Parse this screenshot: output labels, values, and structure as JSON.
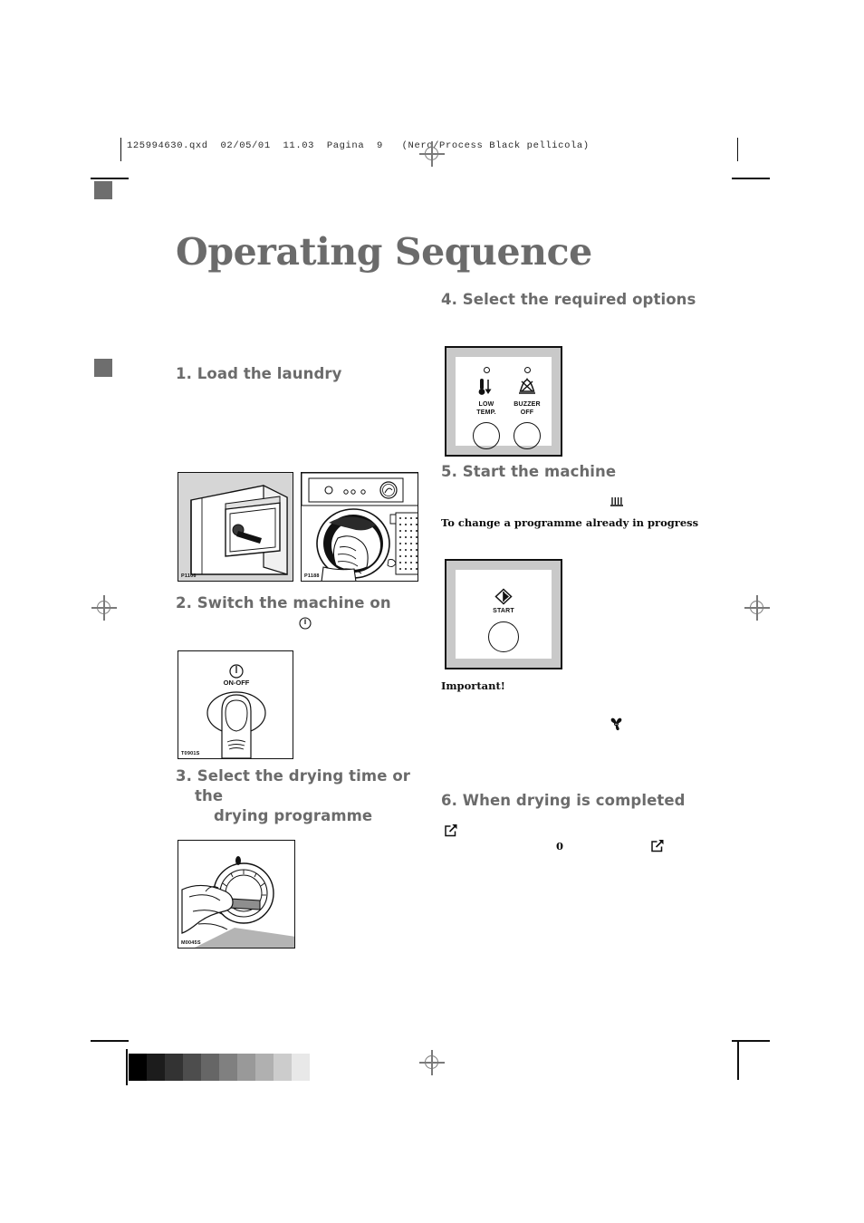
{
  "prepress": {
    "header_line": "125994630.qxd  02/05/01  11.03  Pagina  9   (Nero/Process Black pellicola)",
    "greyscale_steps": [
      "#000000",
      "#1c1c1c",
      "#333333",
      "#4d4d4d",
      "#666666",
      "#808080",
      "#999999",
      "#b0b0b0",
      "#cccccc",
      "#e8e8e8"
    ],
    "marker_color": "#6e6e6e"
  },
  "page": {
    "title": "Operating Sequence"
  },
  "left_column": {
    "step1": {
      "heading": "1. Load the laundry",
      "image_a_code": "P1106",
      "image_b_code": "P1188"
    },
    "step2": {
      "heading": "2. Switch the machine on",
      "power_glyph": "Ⓘ",
      "panel": {
        "button_label": "ON-OFF",
        "image_code": "T0901S"
      }
    },
    "step3": {
      "heading_line1": "3. Select the drying time or the",
      "heading_line2": "drying programme",
      "image_code": "M0045S"
    }
  },
  "right_column": {
    "step4": {
      "heading": "4. Select the required options",
      "options": [
        {
          "label_line1": "LOW",
          "label_line2": "TEMP.",
          "icon": "thermometer-down-icon"
        },
        {
          "label_line1": "BUZZER",
          "label_line2": "OFF",
          "icon": "buzzer-off-icon"
        }
      ]
    },
    "step5": {
      "heading": "5. Start the machine",
      "heater_glyph": "heater-icon",
      "note": "To change a programme already in progress",
      "panel": {
        "start_label": "START"
      },
      "important": "Important!",
      "fan_glyph": "fan-icon"
    },
    "step6": {
      "heading": "6. When drying is completed",
      "arrow_glyph_left": "arrow-out-box-icon",
      "zero_value": "0",
      "arrow_glyph_right": "arrow-out-box-icon"
    }
  }
}
